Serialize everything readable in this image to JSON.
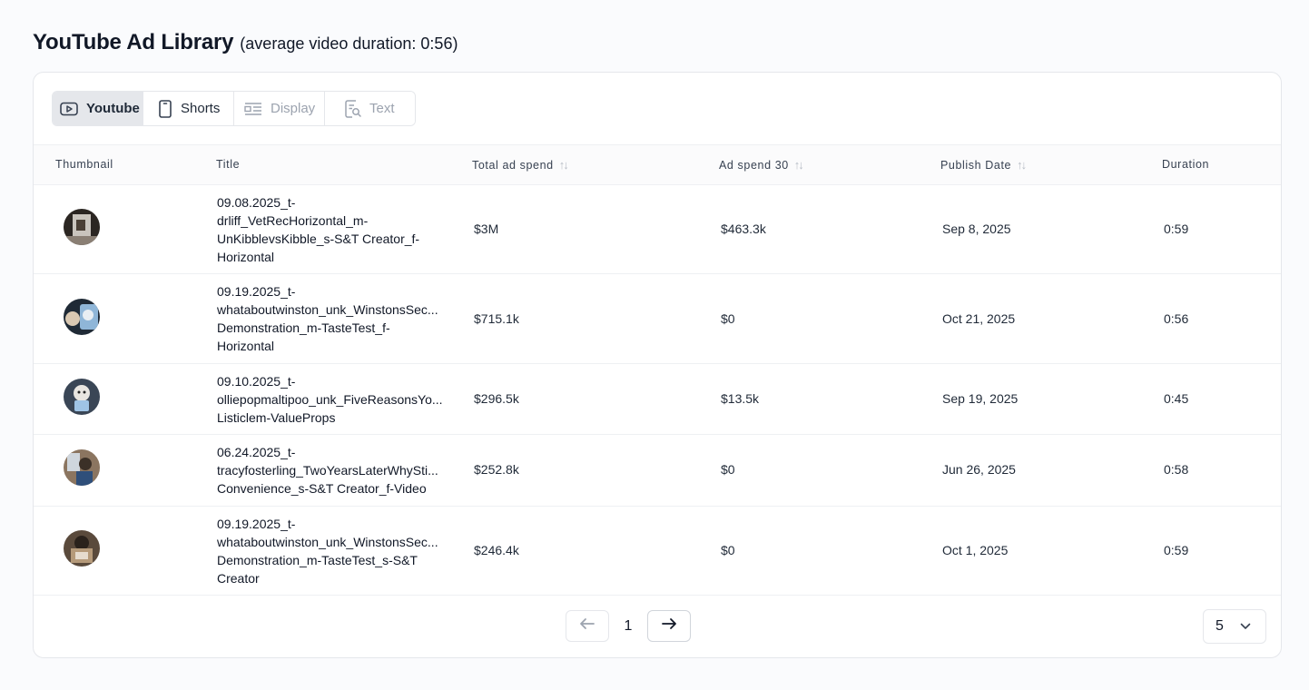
{
  "header": {
    "title": "YouTube Ad Library",
    "subtitle": "(average video duration: 0:56)"
  },
  "tabs": [
    {
      "label": "Youtube",
      "icon": "play-icon",
      "state": "active"
    },
    {
      "label": "Shorts",
      "icon": "phone-icon",
      "state": "normal"
    },
    {
      "label": "Display",
      "icon": "display-layout-icon",
      "state": "disabled"
    },
    {
      "label": "Text",
      "icon": "text-search-icon",
      "state": "disabled"
    }
  ],
  "table": {
    "columns": [
      "Thumbnail",
      "Title",
      "Total ad spend",
      "Ad spend 30",
      "Publish Date",
      "Duration"
    ],
    "sortable": [
      false,
      false,
      true,
      true,
      true,
      false
    ],
    "rows": [
      {
        "title_lines": [
          "09.08.2025_t-",
          "drliff_VetRecHorizontal_m-",
          "UnKibblevsKibble_s-S&T Creator_f-",
          "Horizontal"
        ],
        "total_spend": "$3M",
        "spend_30": "$463.3k",
        "publish_date": "Sep 8, 2025",
        "duration": "0:59"
      },
      {
        "title_lines": [
          "09.19.2025_t-",
          "whataboutwinston_unk_WinstonsSec...",
          "Demonstration_m-TasteTest_f-",
          "Horizontal"
        ],
        "total_spend": "$715.1k",
        "spend_30": "$0",
        "publish_date": "Oct 21, 2025",
        "duration": "0:56"
      },
      {
        "title_lines": [
          "09.10.2025_t-",
          "olliepopmaltipoo_unk_FiveReasonsYo...",
          "Listiclem-ValueProps"
        ],
        "total_spend": "$296.5k",
        "spend_30": "$13.5k",
        "publish_date": "Sep 19, 2025",
        "duration": "0:45"
      },
      {
        "title_lines": [
          "06.24.2025_t-",
          "tracyfosterling_TwoYearsLaterWhySti...",
          "Convenience_s-S&T Creator_f-Video"
        ],
        "total_spend": "$252.8k",
        "spend_30": "$0",
        "publish_date": "Jun 26, 2025",
        "duration": "0:58"
      },
      {
        "title_lines": [
          "09.19.2025_t-",
          "whataboutwinston_unk_WinstonsSec...",
          "Demonstration_m-TasteTest_s-S&T",
          "Creator"
        ],
        "total_spend": "$246.4k",
        "spend_30": "$0",
        "publish_date": "Oct 1, 2025",
        "duration": "0:59"
      }
    ]
  },
  "pagination": {
    "current_page": "1",
    "page_size": "5"
  },
  "colors": {
    "background": "#fafbfd",
    "card": "#ffffff",
    "border": "#e5e7eb",
    "active_tab": "#e5e7eb",
    "text": "#111827",
    "muted": "#9ca3af"
  }
}
